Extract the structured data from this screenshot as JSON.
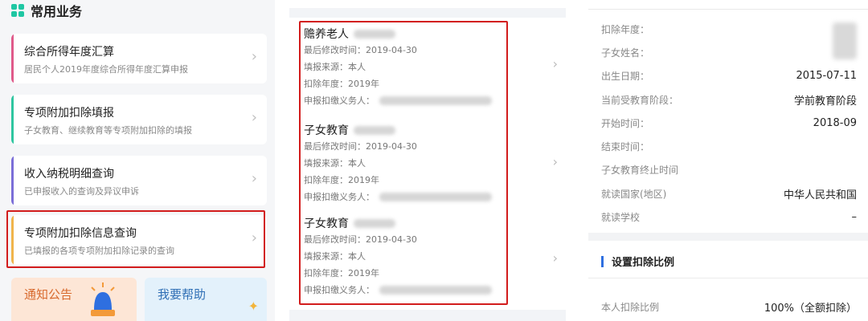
{
  "left": {
    "section_title": "常用业务",
    "cards": [
      {
        "title": "综合所得年度汇算",
        "subtitle": "居民个人2019年度综合所得年度汇算申报",
        "accent": "#e05a8a"
      },
      {
        "title": "专项附加扣除填报",
        "subtitle": "子女教育、继续教育等专项附加扣除的填报",
        "accent": "#2fc6a0"
      },
      {
        "title": "收入纳税明细查询",
        "subtitle": "已申报收入的查询及异议申诉",
        "accent": "#7b6ed8"
      },
      {
        "title": "专项附加扣除信息查询",
        "subtitle": "已填报的各项专项附加扣除记录的查询",
        "accent": "#f0b44c"
      }
    ],
    "tiles": {
      "notice": "通知公告",
      "help": "我要帮助"
    },
    "highlight_color": "#d21c1c"
  },
  "middle": {
    "records": [
      {
        "title": "赡养老人",
        "modified": "最后修改时间：2019-04-30",
        "source": "填报来源：本人",
        "year": "扣除年度：2019年",
        "agent": "申报扣缴义务人："
      },
      {
        "title": "子女教育",
        "modified": "最后修改时间：2019-04-30",
        "source": "填报来源：本人",
        "year": "扣除年度：2019年",
        "agent": "申报扣缴义务人："
      },
      {
        "title": "子女教育",
        "modified": "最后修改时间：2019-04-30",
        "source": "填报来源：本人",
        "year": "扣除年度：2019年",
        "agent": "申报扣缴义务人："
      }
    ]
  },
  "right": {
    "fields": [
      {
        "label": "扣除年度：",
        "value": ""
      },
      {
        "label": "子女姓名：",
        "value": ""
      },
      {
        "label": "出生日期：",
        "value": "2015-07-11"
      },
      {
        "label": "当前受教育阶段：",
        "value": "学前教育阶段"
      },
      {
        "label": "开始时间：",
        "value": "2018-09"
      },
      {
        "label": "结束时间：",
        "value": ""
      },
      {
        "label": "子女教育终止时间",
        "value": ""
      },
      {
        "label": "就读国家(地区)",
        "value": "中华人民共和国"
      },
      {
        "label": "就读学校",
        "value": "–"
      }
    ],
    "section_title": "设置扣除比例",
    "ratio_label": "本人扣除比例",
    "ratio_value": "100%（全额扣除）"
  }
}
